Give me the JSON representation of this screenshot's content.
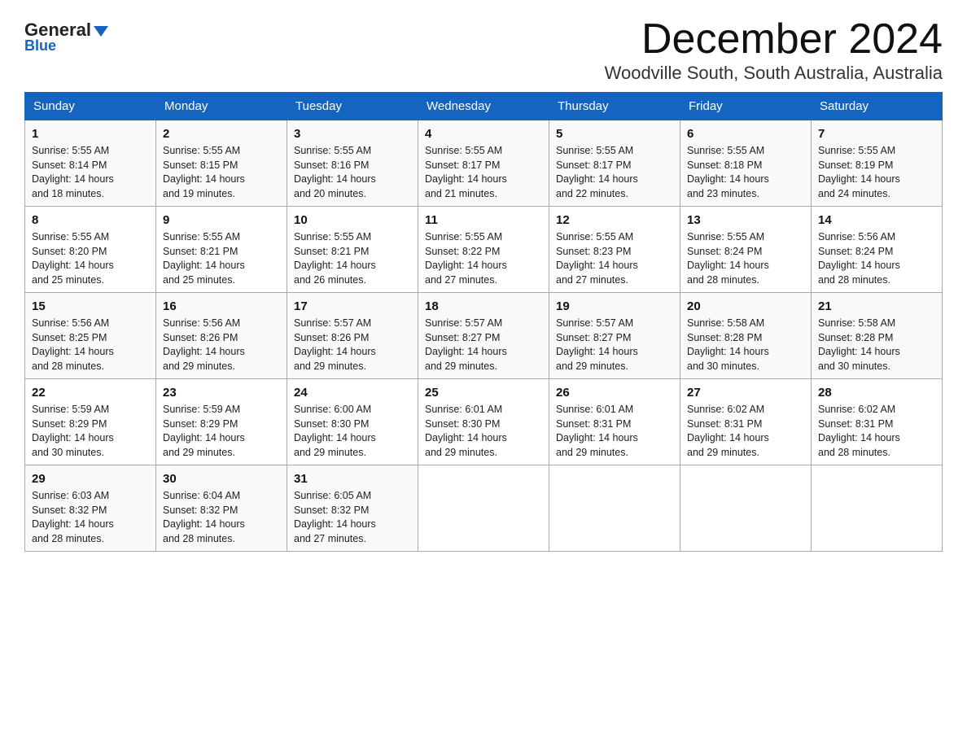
{
  "header": {
    "logo_general": "General",
    "logo_blue": "Blue",
    "month_title": "December 2024",
    "location": "Woodville South, South Australia, Australia"
  },
  "weekdays": [
    "Sunday",
    "Monday",
    "Tuesday",
    "Wednesday",
    "Thursday",
    "Friday",
    "Saturday"
  ],
  "weeks": [
    [
      {
        "day": "1",
        "sunrise": "5:55 AM",
        "sunset": "8:14 PM",
        "daylight": "14 hours and 18 minutes."
      },
      {
        "day": "2",
        "sunrise": "5:55 AM",
        "sunset": "8:15 PM",
        "daylight": "14 hours and 19 minutes."
      },
      {
        "day": "3",
        "sunrise": "5:55 AM",
        "sunset": "8:16 PM",
        "daylight": "14 hours and 20 minutes."
      },
      {
        "day": "4",
        "sunrise": "5:55 AM",
        "sunset": "8:17 PM",
        "daylight": "14 hours and 21 minutes."
      },
      {
        "day": "5",
        "sunrise": "5:55 AM",
        "sunset": "8:17 PM",
        "daylight": "14 hours and 22 minutes."
      },
      {
        "day": "6",
        "sunrise": "5:55 AM",
        "sunset": "8:18 PM",
        "daylight": "14 hours and 23 minutes."
      },
      {
        "day": "7",
        "sunrise": "5:55 AM",
        "sunset": "8:19 PM",
        "daylight": "14 hours and 24 minutes."
      }
    ],
    [
      {
        "day": "8",
        "sunrise": "5:55 AM",
        "sunset": "8:20 PM",
        "daylight": "14 hours and 25 minutes."
      },
      {
        "day": "9",
        "sunrise": "5:55 AM",
        "sunset": "8:21 PM",
        "daylight": "14 hours and 25 minutes."
      },
      {
        "day": "10",
        "sunrise": "5:55 AM",
        "sunset": "8:21 PM",
        "daylight": "14 hours and 26 minutes."
      },
      {
        "day": "11",
        "sunrise": "5:55 AM",
        "sunset": "8:22 PM",
        "daylight": "14 hours and 27 minutes."
      },
      {
        "day": "12",
        "sunrise": "5:55 AM",
        "sunset": "8:23 PM",
        "daylight": "14 hours and 27 minutes."
      },
      {
        "day": "13",
        "sunrise": "5:55 AM",
        "sunset": "8:24 PM",
        "daylight": "14 hours and 28 minutes."
      },
      {
        "day": "14",
        "sunrise": "5:56 AM",
        "sunset": "8:24 PM",
        "daylight": "14 hours and 28 minutes."
      }
    ],
    [
      {
        "day": "15",
        "sunrise": "5:56 AM",
        "sunset": "8:25 PM",
        "daylight": "14 hours and 28 minutes."
      },
      {
        "day": "16",
        "sunrise": "5:56 AM",
        "sunset": "8:26 PM",
        "daylight": "14 hours and 29 minutes."
      },
      {
        "day": "17",
        "sunrise": "5:57 AM",
        "sunset": "8:26 PM",
        "daylight": "14 hours and 29 minutes."
      },
      {
        "day": "18",
        "sunrise": "5:57 AM",
        "sunset": "8:27 PM",
        "daylight": "14 hours and 29 minutes."
      },
      {
        "day": "19",
        "sunrise": "5:57 AM",
        "sunset": "8:27 PM",
        "daylight": "14 hours and 29 minutes."
      },
      {
        "day": "20",
        "sunrise": "5:58 AM",
        "sunset": "8:28 PM",
        "daylight": "14 hours and 30 minutes."
      },
      {
        "day": "21",
        "sunrise": "5:58 AM",
        "sunset": "8:28 PM",
        "daylight": "14 hours and 30 minutes."
      }
    ],
    [
      {
        "day": "22",
        "sunrise": "5:59 AM",
        "sunset": "8:29 PM",
        "daylight": "14 hours and 30 minutes."
      },
      {
        "day": "23",
        "sunrise": "5:59 AM",
        "sunset": "8:29 PM",
        "daylight": "14 hours and 29 minutes."
      },
      {
        "day": "24",
        "sunrise": "6:00 AM",
        "sunset": "8:30 PM",
        "daylight": "14 hours and 29 minutes."
      },
      {
        "day": "25",
        "sunrise": "6:01 AM",
        "sunset": "8:30 PM",
        "daylight": "14 hours and 29 minutes."
      },
      {
        "day": "26",
        "sunrise": "6:01 AM",
        "sunset": "8:31 PM",
        "daylight": "14 hours and 29 minutes."
      },
      {
        "day": "27",
        "sunrise": "6:02 AM",
        "sunset": "8:31 PM",
        "daylight": "14 hours and 29 minutes."
      },
      {
        "day": "28",
        "sunrise": "6:02 AM",
        "sunset": "8:31 PM",
        "daylight": "14 hours and 28 minutes."
      }
    ],
    [
      {
        "day": "29",
        "sunrise": "6:03 AM",
        "sunset": "8:32 PM",
        "daylight": "14 hours and 28 minutes."
      },
      {
        "day": "30",
        "sunrise": "6:04 AM",
        "sunset": "8:32 PM",
        "daylight": "14 hours and 28 minutes."
      },
      {
        "day": "31",
        "sunrise": "6:05 AM",
        "sunset": "8:32 PM",
        "daylight": "14 hours and 27 minutes."
      },
      null,
      null,
      null,
      null
    ]
  ],
  "labels": {
    "sunrise": "Sunrise:",
    "sunset": "Sunset:",
    "daylight": "Daylight:"
  }
}
